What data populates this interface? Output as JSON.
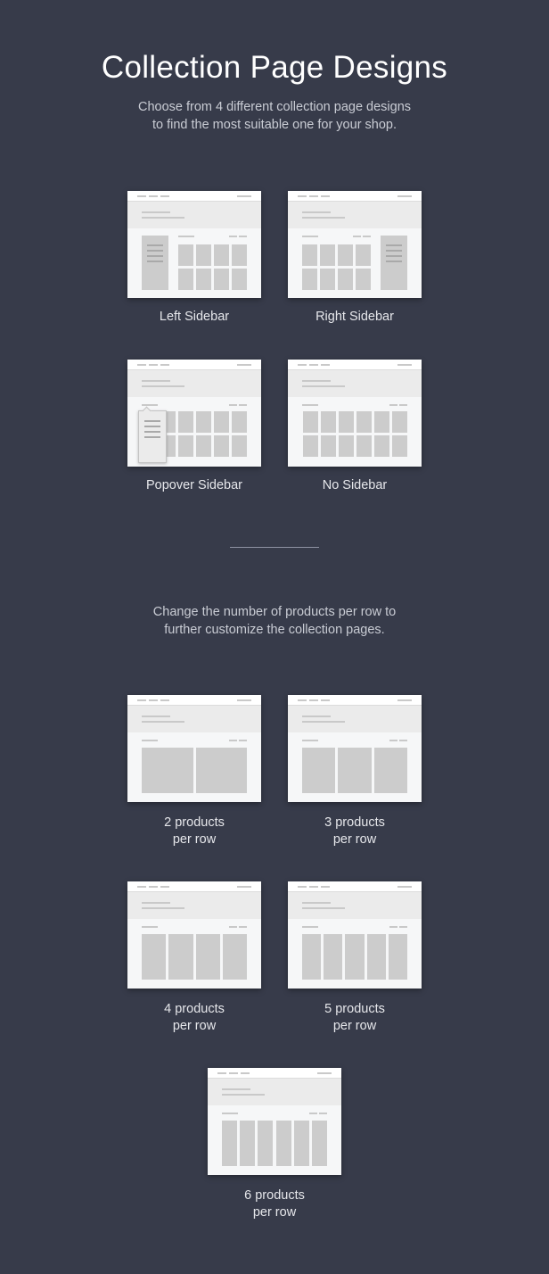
{
  "header": {
    "title": "Collection Page Designs",
    "subtitle_lines": [
      "Choose from 4 different collection page designs",
      "to find the most suitable one for your shop."
    ]
  },
  "designs": [
    {
      "id": "left-sidebar",
      "label": "Left Sidebar",
      "layout": "left"
    },
    {
      "id": "right-sidebar",
      "label": "Right Sidebar",
      "layout": "right"
    },
    {
      "id": "popover-sidebar",
      "label": "Popover Sidebar",
      "layout": "popover"
    },
    {
      "id": "no-sidebar",
      "label": "No Sidebar",
      "layout": "none"
    }
  ],
  "products_section": {
    "subtitle_lines": [
      "Change the number of products per row to",
      "further customize the collection pages."
    ],
    "options": [
      {
        "count": 2,
        "label_lines": [
          "2 products",
          "per row"
        ]
      },
      {
        "count": 3,
        "label_lines": [
          "3 products",
          "per row"
        ]
      },
      {
        "count": 4,
        "label_lines": [
          "4 products",
          "per row"
        ]
      },
      {
        "count": 5,
        "label_lines": [
          "5 products",
          "per row"
        ]
      },
      {
        "count": 6,
        "label_lines": [
          "6 products",
          "per row"
        ]
      }
    ]
  },
  "colors": {
    "background": "#373b4a",
    "thumb_bg": "#f6f7f8",
    "hero_bg": "#ebebeb",
    "placeholder": "#cccccc"
  }
}
